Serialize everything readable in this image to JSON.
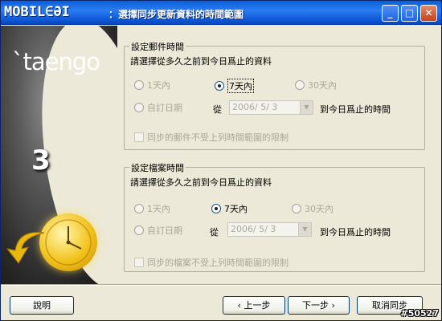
{
  "titlebar": {
    "brand": "MOBIL∈ƏI",
    "title": "：選擇同步更新資料的時間範圍",
    "minimize_glyph": "_",
    "maximize_glyph": "□",
    "close_glyph": "✕"
  },
  "left_panel": {
    "logo": "`taengo",
    "step": "3"
  },
  "mail_group": {
    "title": "設定郵件時間",
    "description": "請選擇從多久之前到今日爲止的資料",
    "options": [
      "1天內",
      "7天內",
      "30天內",
      "自訂日期"
    ],
    "selected": "7天內",
    "from_label": "從",
    "date_value": "2006/ 5/ 3",
    "until_label": "到今日爲止的時間",
    "checkbox_label": "同步的郵件不受上列時間範圍的限制"
  },
  "file_group": {
    "title": "設定檔案時間",
    "description": "請選擇從多久之前到今日爲止的資料",
    "options": [
      "1天內",
      "7天內",
      "30天內",
      "自訂日期"
    ],
    "selected": "7天內",
    "from_label": "從",
    "date_value": "2006/ 5/ 3",
    "until_label": "到今日爲止的時間",
    "checkbox_label": "同步的檔案不受上列時間範圍的限制"
  },
  "buttons": {
    "help": "說明",
    "back": "‹ 上一步",
    "next": "下一步 ›",
    "cancel": "取消同步"
  },
  "watermark": "#50527",
  "colors": {
    "titlebar": "#0b55d4",
    "window_bg": "#ece9d8",
    "disabled_text": "#aca899"
  }
}
